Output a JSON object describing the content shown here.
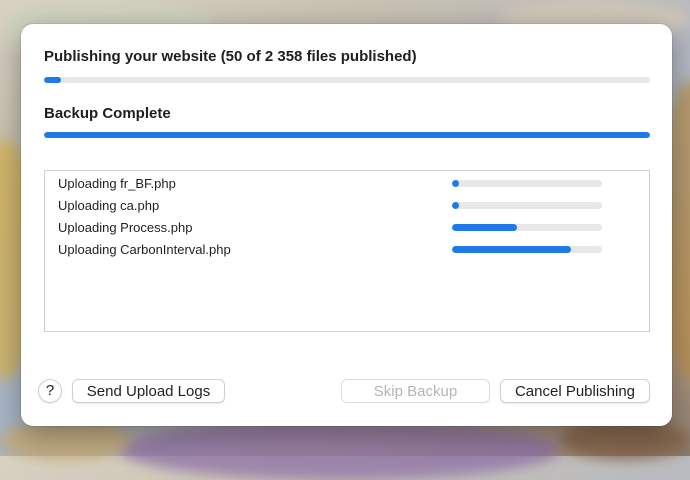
{
  "dialog": {
    "publish_title": "Publishing your website (50 of 2 358 files published)",
    "publish_progress": 0.028,
    "backup_title": "Backup Complete",
    "backup_progress": 1.0
  },
  "uploads": [
    {
      "label": "Uploading fr_BF.php",
      "progress": 0.0
    },
    {
      "label": "Uploading ca.php",
      "progress": 0.0
    },
    {
      "label": "Uploading Process.php",
      "progress": 0.43
    },
    {
      "label": "Uploading CarbonInterval.php",
      "progress": 0.79
    }
  ],
  "buttons": {
    "help_label": "?",
    "send_logs_label": "Send Upload Logs",
    "skip_backup_label": "Skip Backup",
    "cancel_label": "Cancel Publishing"
  },
  "colors": {
    "accent": "#1f7ae8",
    "track": "#e7e7e7"
  }
}
